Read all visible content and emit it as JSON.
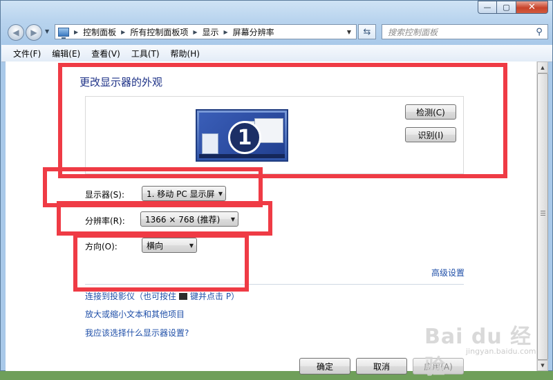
{
  "window": {
    "caption": {
      "min_glyph": "—",
      "max_glyph": "▢",
      "close_glyph": "✕"
    }
  },
  "nav": {
    "back_glyph": "◀",
    "forward_glyph": "▶",
    "breadcrumbs": [
      "控制面板",
      "所有控制面板项",
      "显示",
      "屏幕分辨率"
    ],
    "search_placeholder": "搜索控制面板"
  },
  "menu": {
    "items": [
      "文件(F)",
      "编辑(E)",
      "查看(V)",
      "工具(T)",
      "帮助(H)"
    ]
  },
  "main": {
    "title": "更改显示器的外观",
    "monitor_number": "1",
    "detect_label": "检测(C)",
    "identify_label": "识别(I)",
    "display_label": "显示器(S):",
    "display_value": "1. 移动 PC 显示屏",
    "resolution_label": "分辨率(R):",
    "resolution_value": "1366 × 768 (推荐)",
    "orientation_label": "方向(O):",
    "orientation_value": "横向",
    "advanced_link": "高级设置",
    "link_projector_a": "连接到投影仪（也可按住",
    "link_projector_b": "键并点击 P）",
    "link_text_size": "放大或缩小文本和其他项目",
    "link_which_settings": "我应该选择什么显示器设置?",
    "ok_label": "确定",
    "cancel_label": "取消",
    "apply_label": "应用(A)"
  },
  "watermark": {
    "main": "Bai du 经验",
    "sub": "jingyan.baidu.com"
  },
  "colors": {
    "annotation_red": "#ef3b45",
    "link_blue": "#1f4fa8",
    "title_blue": "#1e3287"
  }
}
